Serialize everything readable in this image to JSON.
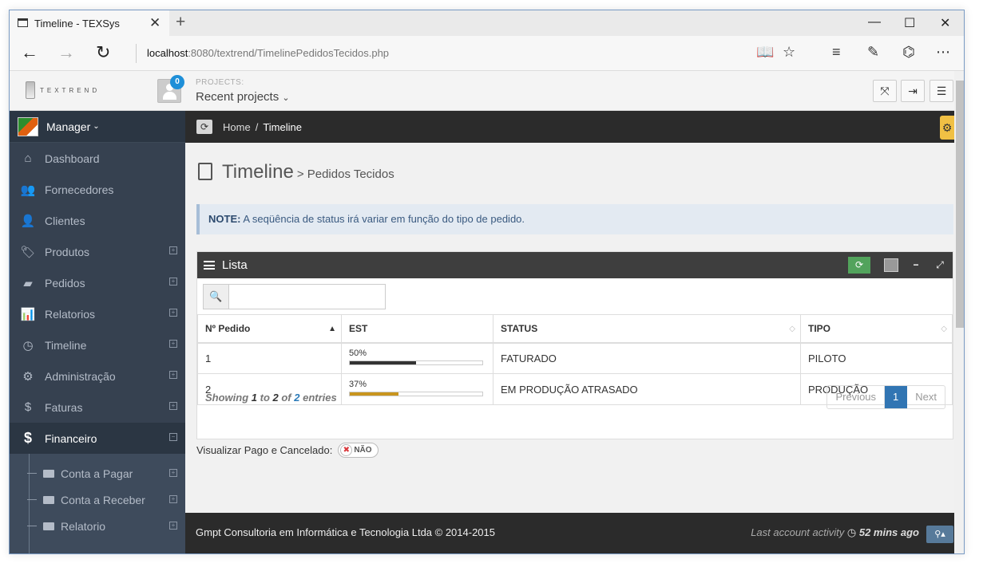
{
  "browser": {
    "tab_title": "Timeline - TEXSys",
    "url_host": "localhost",
    "url_rest": ":8080/textrend/TimelinePedidosTecidos.php"
  },
  "app": {
    "logo_text": "TEXTREND",
    "notif_count": "0",
    "projects_label": "PROJECTS:",
    "projects_value": "Recent projects"
  },
  "sidebar": {
    "user": "Manager",
    "items": [
      {
        "label": "Dashboard",
        "icon": "home-icon"
      },
      {
        "label": "Fornecedores",
        "icon": "group-icon"
      },
      {
        "label": "Clientes",
        "icon": "user-icon"
      },
      {
        "label": "Produtos",
        "icon": "tags-icon"
      },
      {
        "label": "Pedidos",
        "icon": "book-icon"
      },
      {
        "label": "Relatorios",
        "icon": "bar-chart-icon"
      },
      {
        "label": "Timeline",
        "icon": "clock-icon"
      },
      {
        "label": "Administração",
        "icon": "cogs-icon"
      },
      {
        "label": "Faturas",
        "icon": "dollar-icon"
      },
      {
        "label": "Financeiro",
        "icon": "dollar-icon"
      }
    ],
    "subitems": [
      {
        "label": "Conta a Pagar"
      },
      {
        "label": "Conta a Receber"
      },
      {
        "label": "Relatorio"
      }
    ]
  },
  "breadcrumb": {
    "home": "Home",
    "current": "Timeline"
  },
  "page": {
    "title": "Timeline",
    "subtitle": "> Pedidos Tecidos",
    "note_label": "NOTE:",
    "note_text": " A seqüência de status irá variar em função do tipo de pedido."
  },
  "portlet": {
    "title": "Lista",
    "search_value": "",
    "columns": [
      "Nº Pedido",
      "EST",
      "STATUS",
      "TIPO"
    ],
    "rows": [
      {
        "id": "1",
        "est_label": "50%",
        "est": 0.5,
        "est_color": "#333333",
        "status": "FATURADO",
        "tipo": "PILOTO"
      },
      {
        "id": "2",
        "est_label": "37%",
        "est": 0.37,
        "est_color": "#c8951e",
        "status": "EM PRODUÇÃO ATRASADO",
        "tipo": "PRODUÇÃO"
      }
    ],
    "info": {
      "prefix": "Showing ",
      "from": "1",
      "to_word": " to ",
      "to": "2",
      "of_word": " of ",
      "total": "2",
      "suffix": " entries"
    },
    "pager": {
      "prev": "Previous",
      "page": "1",
      "next": "Next"
    }
  },
  "toggle": {
    "label": "Visualizar Pago e Cancelado:",
    "value": "NÃO"
  },
  "footer": {
    "copyright": "Gmpt Consultoria em Informática e Tecnologia Ltda © 2014-2015",
    "activity_label": "Last account activity",
    "activity_value": "52 mins ago"
  },
  "colors": {
    "accent": "#3175b3",
    "sidebar": "#364150",
    "warning": "#c8951e"
  }
}
